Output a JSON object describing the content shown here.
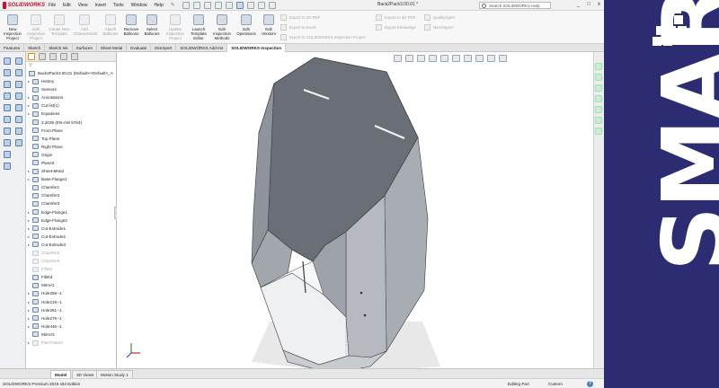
{
  "app": {
    "name": "SOLIDWORKS",
    "menus": [
      "File",
      "Edit",
      "View",
      "Insert",
      "Tools",
      "Window",
      "Help"
    ],
    "document_title": "Back2Pack3.00.01 *",
    "search_placeholder": "Search SOLIDWORKS Help",
    "window_buttons": [
      "_",
      "□",
      "x"
    ]
  },
  "ribbon": {
    "buttons": [
      {
        "label": "New Inspection Project",
        "enabled": true
      },
      {
        "label": "Edit Inspection Project",
        "enabled": false
      },
      {
        "label": "Create New Template",
        "enabled": false
      },
      {
        "label": "Add Characteristic",
        "enabled": false
      },
      {
        "label": "Attach Balloons",
        "enabled": false
      },
      {
        "label": "Remove Balloons",
        "enabled": true
      },
      {
        "label": "Select Balloons",
        "enabled": true
      },
      {
        "label": "Update Inspection Project",
        "enabled": false
      },
      {
        "label": "Launch Template Editor",
        "enabled": true
      },
      {
        "label": "Edit Inspection Methods",
        "enabled": true
      },
      {
        "label": "Edit Operations",
        "enabled": true
      },
      {
        "label": "Edit Vendors",
        "enabled": true
      }
    ],
    "small_buttons": [
      "Export to 2D PDF",
      "Export to Excel",
      "Export to SOLIDWORKS Inspection Project",
      "Export to 3D PDF",
      "Export eDrawings",
      "QualityXpert",
      "Net-Inspect"
    ]
  },
  "command_tabs": [
    {
      "label": "Features",
      "active": false
    },
    {
      "label": "Sketch",
      "active": false
    },
    {
      "label": "Sketch Ink",
      "active": false
    },
    {
      "label": "Surfaces",
      "active": false
    },
    {
      "label": "Sheet Metal",
      "active": false
    },
    {
      "label": "Evaluate",
      "active": false
    },
    {
      "label": "DimXpert",
      "active": false
    },
    {
      "label": "SOLIDWORKS Add-Ins",
      "active": false
    },
    {
      "label": "SOLIDWORKS Inspection",
      "active": true
    }
  ],
  "feature_tree": {
    "root": "Back2Pack3.00.01  (Default<<Default>_A",
    "items": [
      {
        "label": "History",
        "expand": "▸",
        "dim": false
      },
      {
        "label": "Sensors",
        "expand": "",
        "dim": false
      },
      {
        "label": "Annotations",
        "expand": "▸",
        "dim": false
      },
      {
        "label": "Cut list(1)",
        "expand": "▸",
        "dim": false
      },
      {
        "label": "Equations",
        "expand": "▸",
        "dim": false
      },
      {
        "label": "3.2035 (EN-AW 5754)",
        "expand": "",
        "dim": false
      },
      {
        "label": "Front Plane",
        "expand": "",
        "dim": false
      },
      {
        "label": "Top Plane",
        "expand": "",
        "dim": false
      },
      {
        "label": "Right Plane",
        "expand": "",
        "dim": false
      },
      {
        "label": "Origin",
        "expand": "",
        "dim": false
      },
      {
        "label": "Plane2",
        "expand": "",
        "dim": false
      },
      {
        "label": "Sheet-Metal",
        "expand": "▸",
        "dim": false
      },
      {
        "label": "Base-Flange1",
        "expand": "▸",
        "dim": false
      },
      {
        "label": "Chamfer1",
        "expand": "",
        "dim": false
      },
      {
        "label": "Chamfer2",
        "expand": "",
        "dim": false
      },
      {
        "label": "Chamfer3",
        "expand": "",
        "dim": false
      },
      {
        "label": "Edge-Flange1",
        "expand": "▸",
        "dim": false
      },
      {
        "label": "Edge-Flange2",
        "expand": "▸",
        "dim": false
      },
      {
        "label": "Cut-Extrude1",
        "expand": "▸",
        "dim": false
      },
      {
        "label": "Cut-Extrude2",
        "expand": "▸",
        "dim": false
      },
      {
        "label": "Cut-Extrude3",
        "expand": "▸",
        "dim": false
      },
      {
        "label": "Chamfer4",
        "expand": "",
        "dim": true
      },
      {
        "label": "Chamfer5",
        "expand": "",
        "dim": true
      },
      {
        "label": "Fillet2",
        "expand": "",
        "dim": true
      },
      {
        "label": "Fillet3",
        "expand": "",
        "dim": false
      },
      {
        "label": "Mirror1",
        "expand": "",
        "dim": false
      },
      {
        "label": "Hole255--1",
        "expand": "▸",
        "dim": false
      },
      {
        "label": "Hole218--1",
        "expand": "▸",
        "dim": false
      },
      {
        "label": "Hole261--1",
        "expand": "▸",
        "dim": false
      },
      {
        "label": "Hole276--1",
        "expand": "▸",
        "dim": false
      },
      {
        "label": "Hole446--1",
        "expand": "▸",
        "dim": false
      },
      {
        "label": "Mirror3",
        "expand": "",
        "dim": false
      },
      {
        "label": "Flat-Pattern",
        "expand": "▸",
        "dim": true
      }
    ]
  },
  "bottom_tabs": [
    {
      "label": "Model",
      "active": true
    },
    {
      "label": "3D Views",
      "active": false
    },
    {
      "label": "Motion Study 1",
      "active": false
    }
  ],
  "status": {
    "edition": "SOLIDWORKS Premium 2018 x64 Edition",
    "mode": "Editing Part",
    "units": "Custom",
    "help": "?"
  },
  "brand": {
    "text": "SMART",
    "color": "#2b2c72"
  }
}
